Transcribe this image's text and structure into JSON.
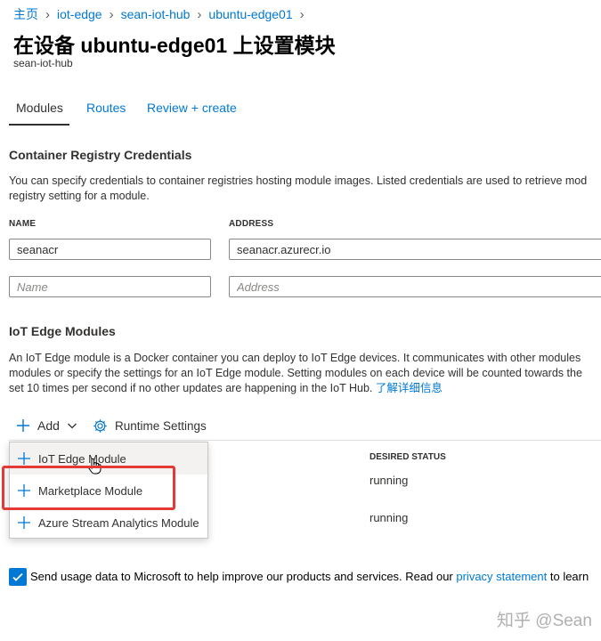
{
  "breadcrumb": [
    "主页",
    "iot-edge",
    "sean-iot-hub",
    "ubuntu-edge01"
  ],
  "page": {
    "title": "在设备 ubuntu-edge01 上设置模块",
    "subtitle": "sean-iot-hub"
  },
  "tabs": [
    {
      "label": "Modules",
      "active": true
    },
    {
      "label": "Routes",
      "active": false
    },
    {
      "label": "Review + create",
      "active": false
    }
  ],
  "registry": {
    "title": "Container Registry Credentials",
    "description_lines": [
      "You can specify credentials to container registries hosting module images. Listed credentials are used to retrieve mod",
      "registry setting for a module."
    ],
    "name_label": "NAME",
    "address_label": "ADDRESS",
    "rows": [
      {
        "name": "seanacr",
        "address": "seanacr.azurecr.io"
      }
    ],
    "placeholders": {
      "name": "Name",
      "address": "Address"
    }
  },
  "modules": {
    "title": "IoT Edge Modules",
    "description_lines": [
      "An IoT Edge module is a Docker container you can deploy to IoT Edge devices. It communicates with other modules",
      "modules or specify the settings for an IoT Edge module. Setting modules on each device will be counted towards the",
      "set 10 times per second if no other updates are happening in the IoT Hub."
    ],
    "learn_more": "了解详细信息",
    "add_label": "Add",
    "runtime_label": "Runtime Settings",
    "status_header": "DESIRED STATUS",
    "statuses": [
      "running",
      "running"
    ]
  },
  "add_menu": {
    "items": [
      "IoT Edge Module",
      "Marketplace Module",
      "Azure Stream Analytics Module"
    ],
    "hovered_index": 0,
    "highlighted_index": 1
  },
  "consent": {
    "checked": true,
    "text": "Send usage data to Microsoft to help improve our products and services. Read our ",
    "link": "privacy statement",
    "tail": " to learn"
  },
  "watermark": "知乎 @Sean",
  "colors": {
    "accent": "#0078d4",
    "highlight": "#e53935",
    "text": "#323130"
  }
}
